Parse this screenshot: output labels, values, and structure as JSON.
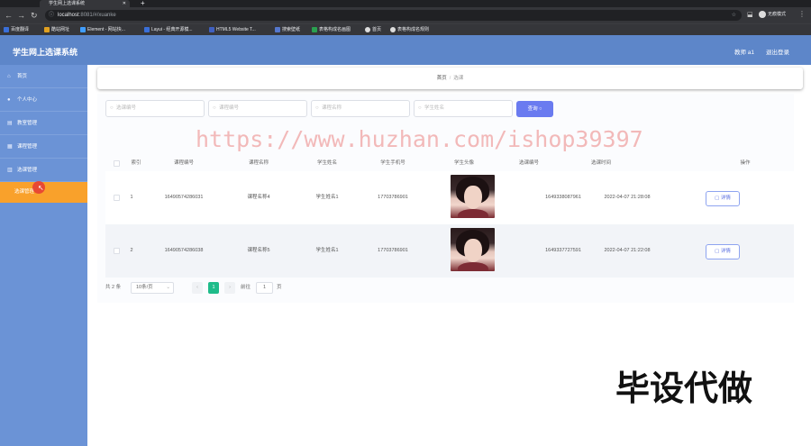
{
  "browser": {
    "tab_title": "学生网上选课系统",
    "address": "localhost",
    "address_rest": ":8081/#/xuanke",
    "profile_label": "无痕模式",
    "bookmarks": [
      "百度翻译",
      "酷站网址",
      "Element - 网站快...",
      "Layui - 经典开源模...",
      "HTML5 Website T...",
      "搜索壁纸",
      "表格构成名画图",
      "首页",
      "表格构成名规则"
    ]
  },
  "header": {
    "title": "学生网上选课系统",
    "user": "教师 a1",
    "logout": "退出登录"
  },
  "sidebar": {
    "items": [
      {
        "label": "首页",
        "icon": "home-icon"
      },
      {
        "label": "个人中心",
        "icon": "user-icon"
      },
      {
        "label": "教室管理",
        "icon": "classroom-icon"
      },
      {
        "label": "课程管理",
        "icon": "course-icon"
      },
      {
        "label": "选课管理",
        "icon": "select-course-icon"
      },
      {
        "label": "选课管理"
      }
    ]
  },
  "breadcrumb": {
    "home": "首页",
    "current": "选课",
    "separator": "/"
  },
  "search": {
    "placeholders": [
      "选课编号",
      "课程编号",
      "课程名称",
      "学生姓名"
    ],
    "query_button": "查询"
  },
  "table": {
    "headers": [
      "索引",
      "课程编号",
      "课程名称",
      "学生姓名",
      "学生手机号",
      "学生头像",
      "选课编号",
      "选课时间",
      "操作"
    ],
    "rows": [
      {
        "index": "1",
        "course_no": "16490574286031",
        "course_name": "课程名称4",
        "student_name": "学生姓名1",
        "phone": "17703786901",
        "select_no": "1649338087961",
        "select_time": "2022-04-07 21:28:08",
        "action": "详情"
      },
      {
        "index": "2",
        "course_no": "16490574286038",
        "course_name": "课程名称5",
        "student_name": "学生姓名1",
        "phone": "17703786901",
        "select_no": "1649337727591",
        "select_time": "2022-04-07 21:22:08",
        "action": "详情"
      }
    ]
  },
  "pagination": {
    "total": "共 2 条",
    "page_size": "10条/页",
    "prev": "‹",
    "current": "1",
    "next": "›",
    "goto_label": "前往",
    "goto_value": "1",
    "page_unit": "页"
  },
  "overlay": {
    "watermark": "https://www.huzhan.com/ishop39397",
    "banner": "毕设代做"
  },
  "colors": {
    "header_bg": "#5d86c9",
    "sidebar_bg": "#6b93d6",
    "active_menu": "#f9a12b",
    "query_button": "#6a7bf0",
    "pager_active": "#1fbc8a"
  }
}
